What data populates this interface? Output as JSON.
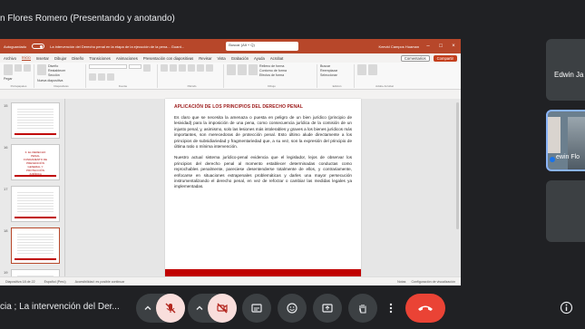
{
  "meet": {
    "presenter_title": "n Flores Romero (Presentando y anotando)",
    "meeting_title": "cia ; La intervención del Der...",
    "participants": [
      {
        "name": "Edwin Ja"
      },
      {
        "name": "ewin Flo"
      }
    ]
  },
  "powerpoint": {
    "autosave_label": "Autoguardado",
    "file_title": "La intervención del Derecho penal en la etapa de la ejecución de la pena...  Guard...",
    "search_placeholder": "Buscar (Alt + Q)",
    "user_name": "Keevid Campos Huaman",
    "menu": [
      "Archivo",
      "Inicio",
      "Insertar",
      "Dibujar",
      "Diseño",
      "Transiciones",
      "Animaciones",
      "Presentación con diapositivas",
      "Revisar",
      "Vista",
      "Grabación",
      "Ayuda",
      "Acrobat"
    ],
    "active_menu": "Inicio",
    "comments_label": "Comentarios",
    "share_label": "Compartir",
    "ribbon": {
      "paste_label": "Pegar",
      "new_slide_label": "Nueva diapositiva",
      "layout_label": "Diseño",
      "reset_label": "Restablecer",
      "section_label": "Sección",
      "groups": [
        "Portapapeles",
        "Diapositivas",
        "Fuente",
        "Párrafo",
        "Dibujo",
        "Edición",
        "Adobe Acrobat"
      ],
      "shapes_label": "Formas",
      "arrange_label": "Organizar",
      "quick_styles_label": "Estilos rápidos",
      "fill_label": "Relleno de forma",
      "outline_label": "Contorno de forma",
      "effects_label": "Efectos de forma",
      "find_label": "Buscar",
      "replace_label": "Reemplazar",
      "select_label": "Seleccionar",
      "pdf_label": "Crear un PDF y compartir vínculo",
      "pdf2_label": "Crear PDF y compartir vínculo"
    },
    "thumbnails": [
      {
        "num": "15",
        "kind": "lines"
      },
      {
        "num": "16",
        "kind": "title",
        "text": "II. EL DERECHO PENAL FUNDAMENTO DE PREVENCIÓN GENERAL Y PROTECCIÓN JURÍDICA"
      },
      {
        "num": "17",
        "kind": "lines"
      },
      {
        "num": "18",
        "kind": "lines"
      },
      {
        "num": "19",
        "kind": "lines"
      }
    ],
    "slide": {
      "title": "Aplicación de los principios del derecho penal",
      "paragraphs": [
        "Es claro que se necesita la amenaza o puesta en peligro de un bien jurídico (principio de lesividad) para la imposición de una pena, como consecuencia jurídica de la comisión de un injusto penal, y, asimismo, solo las lesiones más intolerables y graves a los bienes jurídicos más importantes, son merecedoras de protección penal. Esto último alude directamente a los principios de subsidiariedad y fragmentariedad que, a su vez, son la expresión del principio de última ratio o mínima intervención.",
        "Nuestro actual sistema jurídico-penal evidencia que el legislador, lejos de observar los principios del derecho penal al momento establecer determinadas conductas como reprochables penalmente, pareciese desentenderse totalmente de ellos, y contrariamente, enfocarse en situaciones extrapenales problemáticas y darles una mayor persecución instrumentalizando el derecho penal, en vez de reforzar o cambiar las medidas legales ya implementadas."
      ]
    },
    "status": {
      "slide_pos": "Diapositiva 18 de 22",
      "language": "Español (Perú)",
      "accessibility": "Accesibilidad: es posible continuar",
      "notes": "Notas",
      "display": "Configuración de visualización"
    }
  },
  "colors": {
    "meet_bg": "#202124",
    "ppt_accent": "#b7472a",
    "slide_red": "#c00000",
    "end_call": "#ea4335"
  },
  "controls": [
    "chevron-up-icon",
    "mic-off-icon",
    "chevron-up-icon",
    "camera-off-icon",
    "captions-icon",
    "emoji-icon",
    "present-icon",
    "raise-hand-icon",
    "more-icon",
    "end-call-icon",
    "info-icon"
  ]
}
